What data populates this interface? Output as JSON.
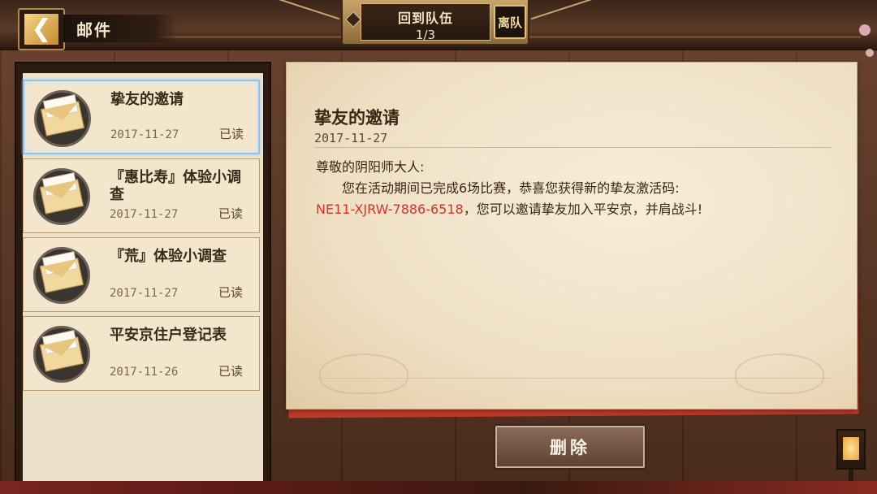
{
  "header": {
    "back_icon": "chevron-left-icon",
    "title": "邮件",
    "team": {
      "label": "回到队伍",
      "count": "1/3",
      "leave_label": "离队"
    }
  },
  "mail_list": [
    {
      "title": "挚友的邀请",
      "date": "2017-11-27",
      "status": "已读",
      "icon": "envelope-icon",
      "selected": true
    },
    {
      "title": "『惠比寿』体验小调查",
      "date": "2017-11-27",
      "status": "已读",
      "icon": "envelope-icon",
      "selected": false
    },
    {
      "title": "『荒』体验小调查",
      "date": "2017-11-27",
      "status": "已读",
      "icon": "envelope-icon",
      "selected": false
    },
    {
      "title": "平安京住户登记表",
      "date": "2017-11-26",
      "status": "已读",
      "icon": "envelope-icon",
      "selected": false
    }
  ],
  "letter": {
    "title": "挚友的邀请",
    "date": "2017-11-27",
    "greeting": "尊敬的阴阳师大人:",
    "body_1": "您在活动期间已完成6场比赛，恭喜您获得新的挚友激活码:",
    "code": "NE11-XJRW-7886-6518",
    "body_2": "，您可以邀请挚友加入平安京，并肩战斗!"
  },
  "actions": {
    "delete_label": "删除"
  },
  "colors": {
    "code_red": "#d0342a",
    "selected_border": "#8fc3ee"
  }
}
